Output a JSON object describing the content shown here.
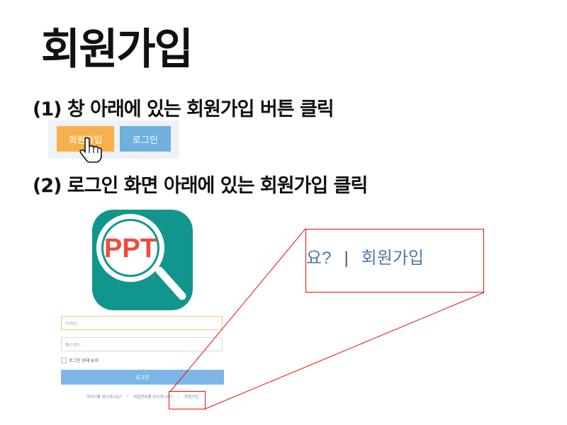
{
  "title": "회원가입",
  "step1": {
    "label": "(1) 창 아래에 있는 회원가입 버튼 클릭"
  },
  "step2": {
    "label": "(2) 로그인 화면 아래에 있는 회원가입 클릭"
  },
  "demo_buttons": {
    "signup": "회원가입",
    "login": "로그인",
    "signup_color": "#f8b04d",
    "login_color": "#6fb0df"
  },
  "app_icon": {
    "text": "PPT",
    "bg_color": "#11968e",
    "icon": "magnifier-icon"
  },
  "login_form": {
    "id_placeholder": "아이디",
    "pw_placeholder": "패스워드",
    "keep_login": "로그인 상태 유지",
    "login_button": "로그인",
    "links": {
      "find_id": "아이디를 잊으셨나요?",
      "find_pw": "비밀번호를 잊으셨나요?",
      "signup": "회원가입",
      "separator": "|"
    }
  },
  "zoom": {
    "prefix": "요?",
    "separator": "|",
    "label": "회원가입"
  },
  "highlight_color": "#e01010"
}
